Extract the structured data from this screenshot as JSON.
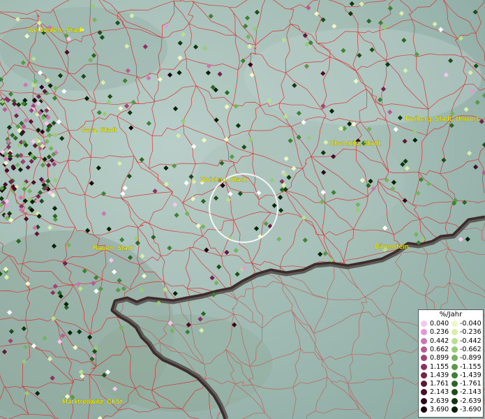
{
  "map": {
    "cities": [
      {
        "name": "Weißenfels, Stadt"
      },
      {
        "name": "Gera, Stadt"
      },
      {
        "name": "Chemnitz, Stadt"
      },
      {
        "name": "Freiberg, Stadt, Univers"
      },
      {
        "name": "Zwickau, Stadt"
      },
      {
        "name": "Plauen, Stadt"
      },
      {
        "name": "Bärenstein"
      },
      {
        "name": "Marktredwitz, GKSt"
      }
    ]
  },
  "legend": {
    "title": "%/Jahr",
    "positive": [
      {
        "label": "0.040",
        "color": "#f2c8ec"
      },
      {
        "label": "0.236",
        "color": "#e39ad4"
      },
      {
        "label": "0.442",
        "color": "#cc77b0"
      },
      {
        "label": "0.662",
        "color": "#b65b94"
      },
      {
        "label": "0.899",
        "color": "#9e4477"
      },
      {
        "label": "1.155",
        "color": "#873260"
      },
      {
        "label": "1.439",
        "color": "#72234c"
      },
      {
        "label": "1.761",
        "color": "#5c1739"
      },
      {
        "label": "2.143",
        "color": "#460d29"
      },
      {
        "label": "2.639",
        "color": "#30061a"
      },
      {
        "label": "3.690",
        "color": "#1c020d"
      }
    ],
    "negative": [
      {
        "label": "-0.040",
        "color": "#eef8c6"
      },
      {
        "label": "-0.236",
        "color": "#d7efaa"
      },
      {
        "label": "-0.442",
        "color": "#b9e08e"
      },
      {
        "label": "-0.662",
        "color": "#97cc76"
      },
      {
        "label": "-0.899",
        "color": "#75b35e"
      },
      {
        "label": "-1.155",
        "color": "#589a48"
      },
      {
        "label": "-1.439",
        "color": "#3f8134"
      },
      {
        "label": "-1.761",
        "color": "#2b6724"
      },
      {
        "label": "-2.143",
        "color": "#1c4f17"
      },
      {
        "label": "-2.639",
        "color": "#10380d"
      },
      {
        "label": "-3.690",
        "color": "#062205"
      }
    ]
  }
}
